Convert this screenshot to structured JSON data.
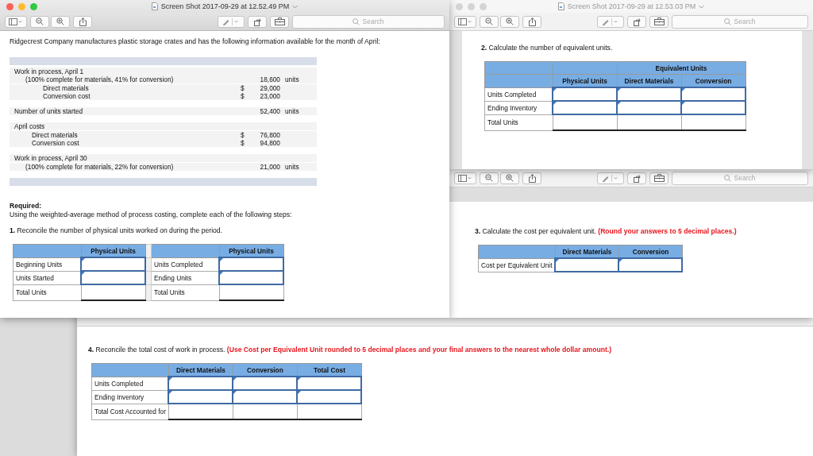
{
  "windows": [
    {
      "title": "Screen Shot 2017-09-29 at 12.52.49 PM",
      "active": true,
      "search_placeholder": "Search",
      "blocks": [
        {
          "kind": "paragraph",
          "text": "Ridgecrest Company manufactures plastic storage crates and has the following information available for the month of April:"
        },
        {
          "kind": "data_sheet",
          "rows": [
            {
              "label": "Work in process, April 1",
              "children": [
                {
                  "label": "(100% complete for materials, 41% for conversion)",
                  "amount": "18,600",
                  "unit": "units",
                  "children": [
                    {
                      "label": "Direct materials",
                      "currency": "$",
                      "amount": "29,000"
                    },
                    {
                      "label": "Conversion cost",
                      "currency": "$",
                      "amount": "23,000"
                    }
                  ]
                }
              ]
            },
            {
              "label": "Number of units started",
              "amount": "52,400",
              "unit": "units"
            },
            {
              "label": "April costs",
              "children": [
                {
                  "label": "Direct materials",
                  "currency": "$",
                  "amount": "76,800"
                },
                {
                  "label": "Conversion cost",
                  "currency": "$",
                  "amount": "94,800"
                }
              ]
            },
            {
              "label": "Work in process, April 30",
              "children": [
                {
                  "label": "(100% complete for materials, 22% for conversion)",
                  "amount": "21,000",
                  "unit": "units"
                }
              ]
            }
          ]
        },
        {
          "kind": "heading",
          "text": "Required:"
        },
        {
          "kind": "paragraph",
          "text": "Using the weighted-average method of process costing, complete each of the following steps:"
        },
        {
          "kind": "step",
          "text": "**1.** Reconcile the number of physical units worked on during the period."
        },
        {
          "kind": "table",
          "header_rows": [
            [
              {
                "kind": "blank"
              },
              {
                "kind": "heading",
                "text": "Physical Units"
              },
              {
                "kind": "gap"
              },
              {
                "kind": "blank"
              },
              {
                "kind": "heading",
                "text": "Physical Units"
              }
            ]
          ],
          "rows": [
            [
              {
                "kind": "label",
                "text": "Beginning Units"
              },
              {
                "kind": "input"
              },
              {
                "kind": "gap"
              },
              {
                "kind": "label",
                "text": "Units Completed"
              },
              {
                "kind": "input"
              }
            ],
            [
              {
                "kind": "label",
                "text": "Units Started"
              },
              {
                "kind": "input"
              },
              {
                "kind": "gap"
              },
              {
                "kind": "label",
                "text": "Ending Units"
              },
              {
                "kind": "input"
              }
            ],
            [
              {
                "kind": "label",
                "text": "Total Units"
              },
              {
                "kind": "total"
              },
              {
                "kind": "gap"
              },
              {
                "kind": "label",
                "text": "Total Units"
              },
              {
                "kind": "total"
              }
            ]
          ]
        }
      ]
    },
    {
      "title": "Screen Shot 2017-09-29 at 12.53.03 PM",
      "active": false,
      "search_placeholder": "Search",
      "blocks": [
        {
          "kind": "step",
          "text": "**2.** Calculate the number of equivalent units."
        },
        {
          "kind": "table",
          "header_rows": [
            [
              {
                "kind": "blank"
              },
              {
                "kind": "blank"
              },
              {
                "kind": "heading",
                "text": "Equivalent Units"
              }
            ],
            [
              {
                "kind": "blank"
              },
              {
                "kind": "heading",
                "text": "Physical Units"
              },
              {
                "kind": "heading",
                "text": "Direct Materials"
              },
              {
                "kind": "heading",
                "text": "Conversion"
              }
            ]
          ],
          "rows": [
            [
              {
                "kind": "label",
                "text": "Units Completed"
              },
              {
                "kind": "input"
              },
              {
                "kind": "input"
              },
              {
                "kind": "input"
              }
            ],
            [
              {
                "kind": "label",
                "text": "Ending Inventory"
              },
              {
                "kind": "input"
              },
              {
                "kind": "input"
              },
              {
                "kind": "input"
              }
            ],
            [
              {
                "kind": "label",
                "text": "Total Units"
              },
              {
                "kind": "total"
              },
              {
                "kind": "total"
              },
              {
                "kind": "total"
              }
            ]
          ]
        }
      ]
    },
    {
      "search_placeholder": "Search",
      "blocks": [
        {
          "kind": "step",
          "text": "**3.** Calculate the cost per equivalent unit.",
          "note": "(Round your answers to 5 decimal places.)"
        },
        {
          "kind": "table",
          "header_rows": [
            [
              {
                "kind": "blank"
              },
              {
                "kind": "heading",
                "text": "Direct Materials"
              },
              {
                "kind": "heading",
                "text": "Conversion"
              }
            ]
          ],
          "rows": [
            [
              {
                "kind": "label",
                "text": "Cost per Equivalent Unit"
              },
              {
                "kind": "input"
              },
              {
                "kind": "input"
              }
            ]
          ]
        }
      ]
    },
    {
      "blocks": [
        {
          "kind": "step",
          "text": "**4.** Reconcile the total cost of work in process.",
          "note": "(Use Cost per Equivalent Unit rounded to 5 decimal places and your final answers to the nearest whole dollar amount.)"
        },
        {
          "kind": "table",
          "header_rows": [
            [
              {
                "kind": "blank"
              },
              {
                "kind": "heading",
                "text": "Direct Materials"
              },
              {
                "kind": "heading",
                "text": "Conversion"
              },
              {
                "kind": "heading",
                "text": "Total Cost"
              }
            ]
          ],
          "rows": [
            [
              {
                "kind": "label",
                "text": "Units Completed"
              },
              {
                "kind": "input"
              },
              {
                "kind": "input"
              },
              {
                "kind": "input"
              }
            ],
            [
              {
                "kind": "label",
                "text": "Ending Inventory"
              },
              {
                "kind": "input"
              },
              {
                "kind": "input"
              },
              {
                "kind": "input"
              }
            ],
            [
              {
                "kind": "label",
                "text": "Total Cost Accounted for"
              },
              {
                "kind": "total"
              },
              {
                "kind": "total"
              },
              {
                "kind": "total"
              }
            ]
          ]
        }
      ]
    }
  ]
}
